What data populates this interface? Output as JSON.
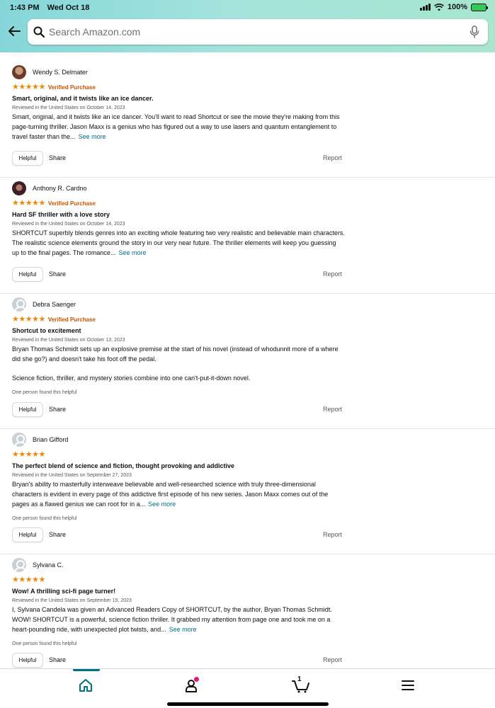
{
  "status_bar": {
    "time": "1:43 PM",
    "date": "Wed Oct 18",
    "battery": "100%"
  },
  "search": {
    "placeholder": "Search Amazon.com"
  },
  "reviews": [
    {
      "reviewer": "Wendy S. Delmater",
      "rating": 5,
      "stars": "★★★★★",
      "verified": "Verified Purchase",
      "title": "Smart, original, and it twists like an ice dancer.",
      "date": "Reviewed in the United States on October 14, 2023",
      "body": [
        "Smart, original, and it twists like an ice dancer. You'll want to read Shortcut or see the movie they're making from this page-turning thriller. Jason Maxx is a genius who has figured out a way to use lasers and quantum entanglement to travel faster than the..."
      ],
      "see_more": "See more",
      "helpful_count": "",
      "helpful": "Helpful",
      "share": "Share",
      "report": "Report"
    },
    {
      "reviewer": "Anthony R. Cardno",
      "rating": 5,
      "stars": "★★★★★",
      "verified": "Verified Purchase",
      "title": "Hard SF thriller with a love story",
      "date": "Reviewed in the United States on October 14, 2023",
      "body": [
        "SHORTCUT superbly blends genres into an exciting whole featuring two very realistic and believable main characters. The realistic science elements ground the story in our very near future. The thriller elements will keep you guessing up to the final pages. The romance..."
      ],
      "see_more": "See more",
      "helpful_count": "",
      "helpful": "Helpful",
      "share": "Share",
      "report": "Report"
    },
    {
      "reviewer": "Debra Saenger",
      "rating": 5,
      "stars": "★★★★★",
      "verified": "Verified Purchase",
      "title": "Shortcut to excitement",
      "date": "Reviewed in the United States on October 13, 2023",
      "body": [
        "Bryan Thomas Schmidt sets up an explosive premise at the start of his novel (instead of whodunnit more of a where did she go?) and doesn't take his foot off the pedal.",
        "Science fiction, thriller, and mystery stories combine into one can't-put-it-down novel."
      ],
      "see_more": "",
      "helpful_count": "One person found this helpful",
      "helpful": "Helpful",
      "share": "Share",
      "report": "Report"
    },
    {
      "reviewer": "Brian Gifford",
      "rating": 5,
      "stars": "★★★★★",
      "verified": "",
      "title": "The perfect blend of science and fiction, thought provoking and addictive",
      "date": "Reviewed in the United States on September 27, 2023",
      "body": [
        "Bryan's ability to masterfully interweave believable and well-researched science with truly three-dimensional characters is evident in every page of this addictive first episode of his new series. Jason Maxx comes out of the pages as a flawed genius we can root for in a..."
      ],
      "see_more": "See more",
      "helpful_count": "One person found this helpful",
      "helpful": "Helpful",
      "share": "Share",
      "report": "Report"
    },
    {
      "reviewer": "Sylvana C.",
      "rating": 5,
      "stars": "★★★★★",
      "verified": "",
      "title": "Wow! A thrilling sci-fi page turner!",
      "date": "Reviewed in the United States on September 19, 2023",
      "body": [
        "I, Sylvana Candela was given an Advanced Readers Copy of SHORTCUT, by the author, Bryan Thomas Schmidt. WOW! SHORTCUT is a powerful, science fiction thriller. It grabbed my attention from page one and took me on a heart-pounding ride, with unexpected plot twists, and..."
      ],
      "see_more": "See more",
      "helpful_count": "One person found this helpful",
      "helpful": "Helpful",
      "share": "Share",
      "report": "Report"
    }
  ],
  "bottom_nav": {
    "items": [
      "home-icon",
      "account-icon",
      "cart-icon",
      "menu-icon"
    ],
    "cart_count": "1",
    "active": "home"
  },
  "colors": {
    "header_gradient_start": "#86d6d9",
    "header_gradient_end": "#a8e6cf",
    "star": "#f08804",
    "verified": "#c45500",
    "link": "#007185",
    "notification": "#e3197a"
  }
}
